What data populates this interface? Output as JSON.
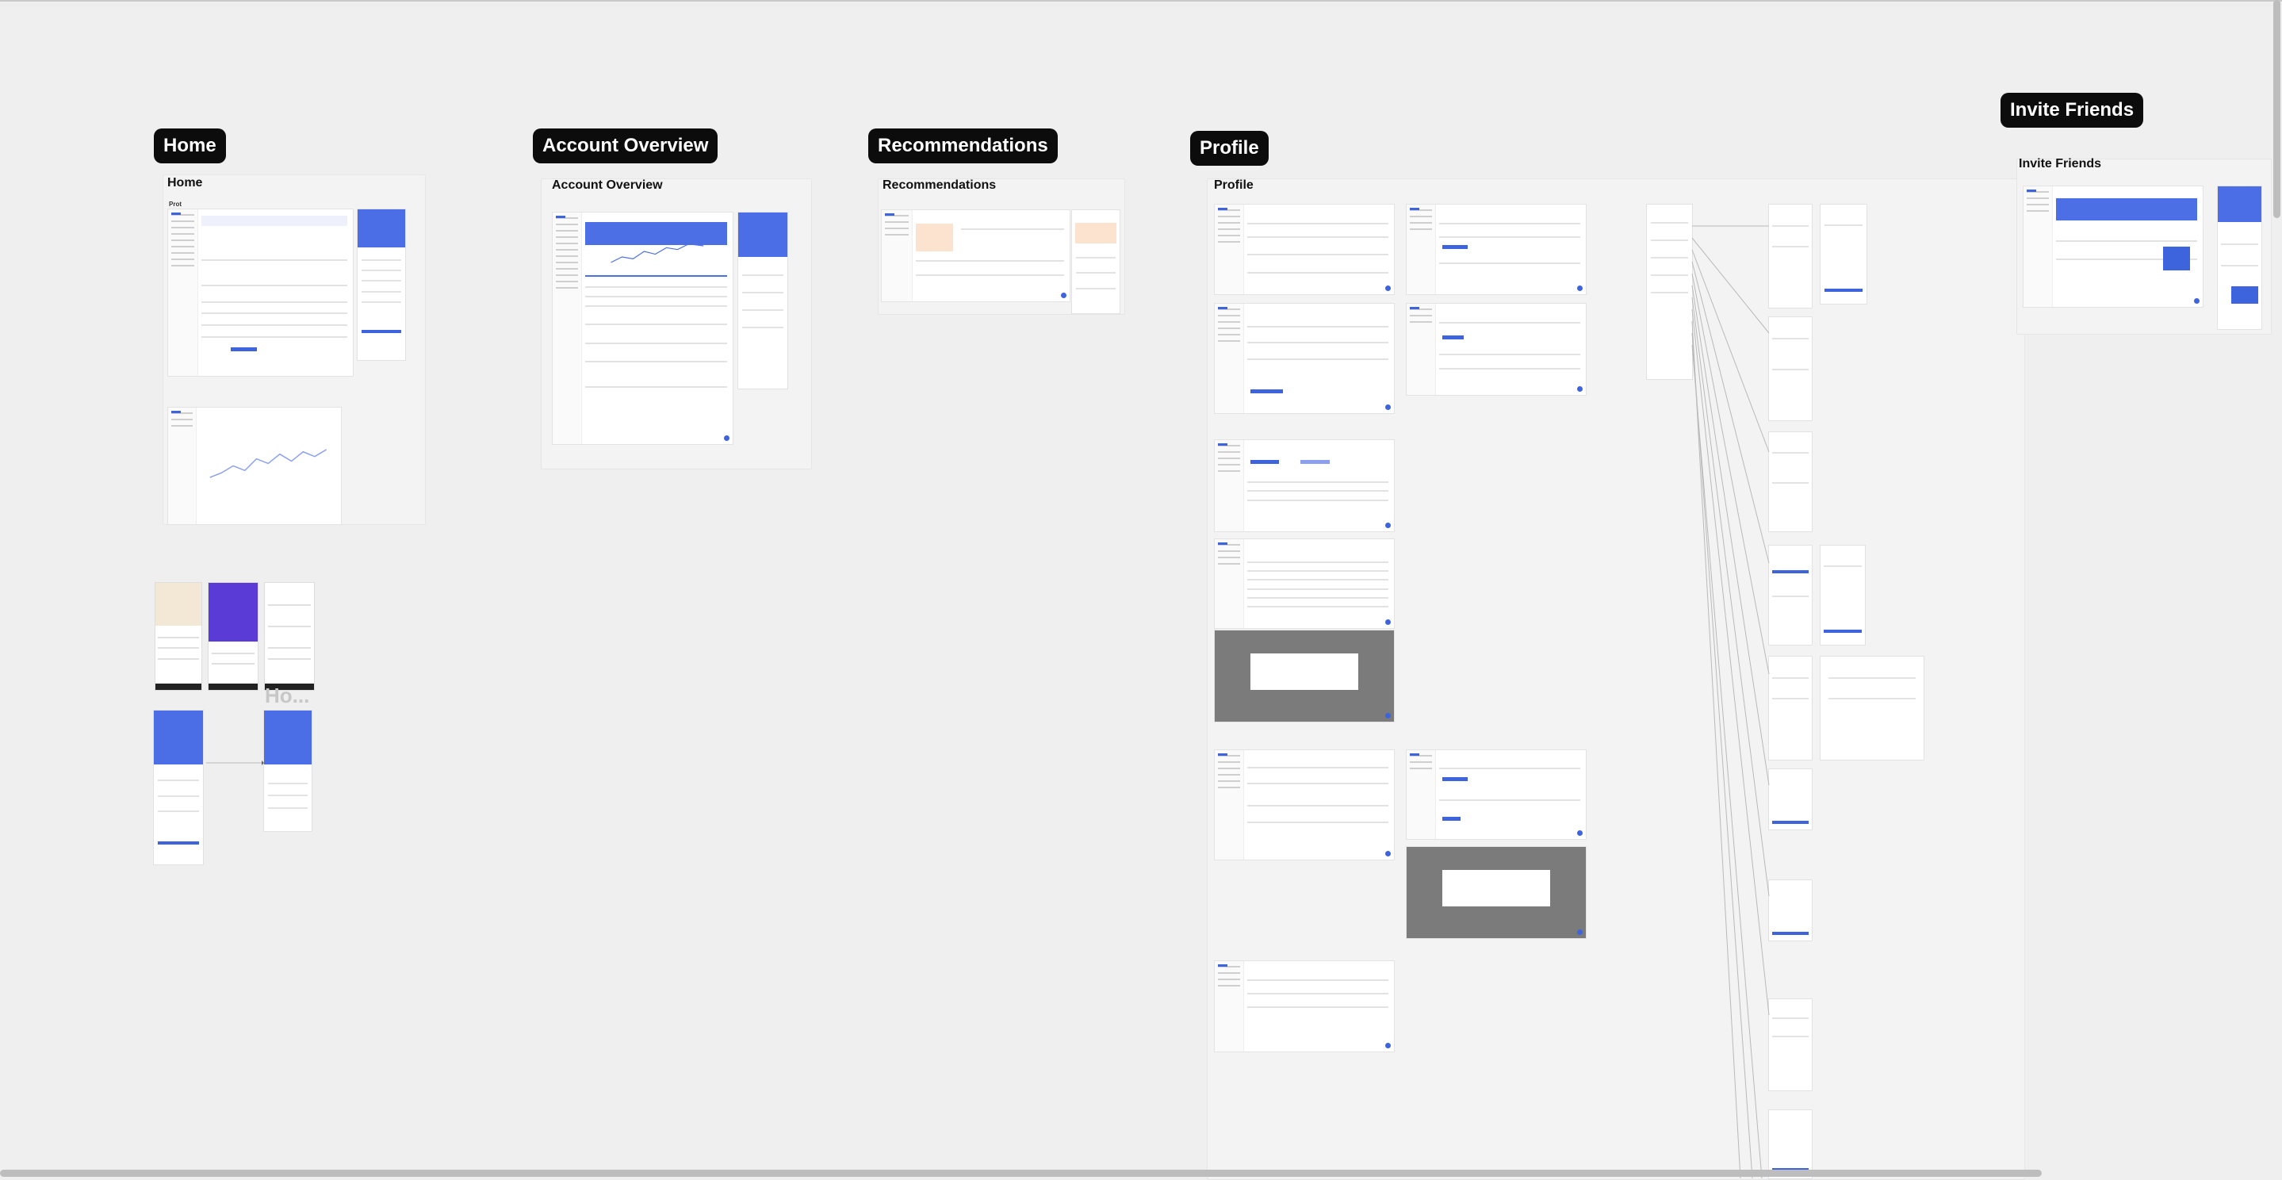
{
  "sections": {
    "home": {
      "pill": "Home",
      "label": "Home",
      "sub": "Prot"
    },
    "account_overview": {
      "pill": "Account Overview",
      "label": "Account Overview"
    },
    "recommendations": {
      "pill": "Recommendations",
      "label": "Recommendations"
    },
    "profile": {
      "pill": "Profile",
      "label": "Profile"
    },
    "invite_friends": {
      "pill": "Invite Friends",
      "label": "Invite Friends"
    }
  },
  "ghost_text": "Ho...",
  "colors": {
    "canvas": "#efefef",
    "pill": "#0c0c0c",
    "accent": "#3d63dd",
    "frame": "#ffffff"
  }
}
